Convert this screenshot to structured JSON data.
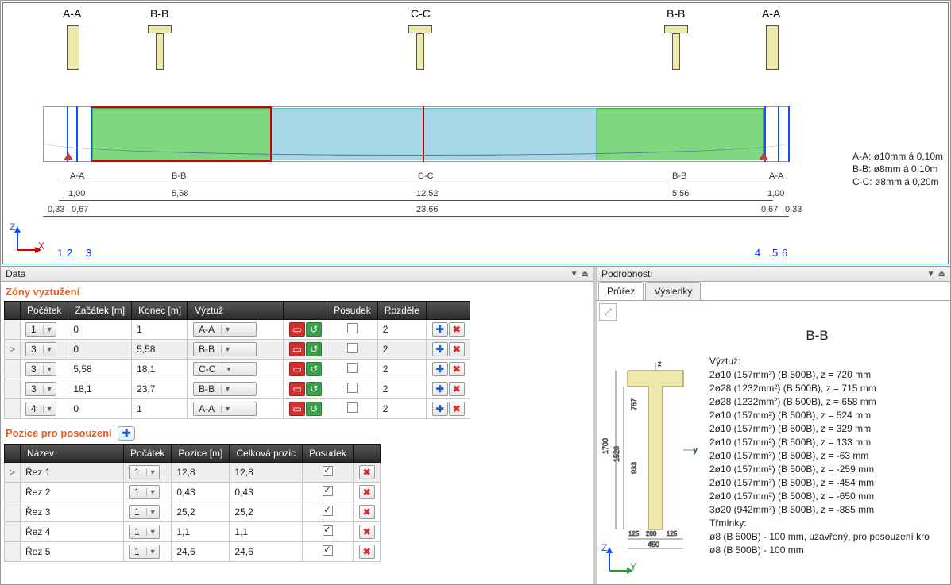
{
  "drawing": {
    "section_labels": [
      "A-A",
      "B-B",
      "C-C",
      "B-B",
      "A-A"
    ],
    "legend": [
      "A-A: ø10mm á 0,10m",
      "B-B: ø8mm á 0,10m",
      "C-C: ø8mm á 0,20m"
    ],
    "dim_row1": {
      "labels": [
        "A-A",
        "B-B",
        "C-C",
        "B-B",
        "A-A"
      ]
    },
    "dim_row2": {
      "labels": [
        "1,00",
        "5,58",
        "12,52",
        "5,56",
        "1,00"
      ]
    },
    "dim_row3": {
      "labels_left": [
        "0,33",
        "0,67"
      ],
      "center": "23,66",
      "labels_right": [
        "0,67",
        "0,33"
      ]
    },
    "nodes_left": [
      "1",
      "2",
      "3"
    ],
    "nodes_right": [
      "4",
      "5",
      "6"
    ],
    "axis_z": "Z",
    "axis_x": "X"
  },
  "panes": {
    "data": "Data",
    "details": "Podrobnosti"
  },
  "zones": {
    "title": "Zóny vyztužení",
    "headers": [
      "Počátek",
      "Začátek [m]",
      "Konec [m]",
      "Výztuž",
      "",
      "Posudek",
      "Rozděle",
      ""
    ],
    "rows": [
      {
        "poc": "1",
        "zac": "0",
        "kon": "1",
        "vyz": "A-A",
        "pos": false,
        "roz": "2",
        "sel": false
      },
      {
        "poc": "3",
        "zac": "0",
        "kon": "5,58",
        "vyz": "B-B",
        "pos": false,
        "roz": "2",
        "sel": true
      },
      {
        "poc": "3",
        "zac": "5,58",
        "kon": "18,1",
        "vyz": "C-C",
        "pos": false,
        "roz": "2",
        "sel": false
      },
      {
        "poc": "3",
        "zac": "18,1",
        "kon": "23,7",
        "vyz": "B-B",
        "pos": false,
        "roz": "2",
        "sel": false
      },
      {
        "poc": "4",
        "zac": "0",
        "kon": "1",
        "vyz": "A-A",
        "pos": false,
        "roz": "2",
        "sel": false
      }
    ]
  },
  "positions": {
    "title": "Pozice pro posouzení",
    "headers": [
      "Název",
      "Počátek",
      "Pozice [m]",
      "Celková pozic",
      "Posudek",
      ""
    ],
    "rows": [
      {
        "name": "Řez 1",
        "poc": "1",
        "poz": "12,8",
        "cel": "12,8",
        "pos": true,
        "sel": true
      },
      {
        "name": "Řez 2",
        "poc": "1",
        "poz": "0,43",
        "cel": "0,43",
        "pos": true,
        "sel": false
      },
      {
        "name": "Řez 3",
        "poc": "1",
        "poz": "25,2",
        "cel": "25,2",
        "pos": true,
        "sel": false
      },
      {
        "name": "Řez 4",
        "poc": "1",
        "poz": "1,1",
        "cel": "1,1",
        "pos": true,
        "sel": false
      },
      {
        "name": "Řez 5",
        "poc": "1",
        "poz": "24,6",
        "cel": "24,6",
        "pos": true,
        "sel": false
      }
    ]
  },
  "details": {
    "tabs": [
      "Průřez",
      "Výsledky"
    ],
    "active_tab": 0,
    "section_name": "B-B",
    "heading": "Výztuž:",
    "lines": [
      "2ø10 (157mm²) (B 500B), z = 720 mm",
      "2ø28 (1232mm²) (B 500B), z = 715 mm",
      "2ø28 (1232mm²) (B 500B), z = 658 mm",
      "2ø10 (157mm²) (B 500B), z = 524 mm",
      "2ø10 (157mm²) (B 500B), z = 329 mm",
      "2ø10 (157mm²) (B 500B), z = 133 mm",
      "2ø10 (157mm²) (B 500B), z = -63 mm",
      "2ø10 (157mm²) (B 500B), z = -259 mm",
      "2ø10 (157mm²) (B 500B), z = -454 mm",
      "2ø10 (157mm²) (B 500B), z = -650 mm",
      "3ø20 (942mm²) (B 500B), z = -885 mm"
    ],
    "stirrups_heading": "Třmínky:",
    "stirrups": [
      "ø8 (B 500B) - 100 mm, uzavřený, pro posouzení kro",
      "ø8 (B 500B) - 100 mm"
    ],
    "dims": {
      "h": "1700",
      "h2": "1520",
      "h3": "933",
      "h4": "767",
      "w1": "125",
      "w2": "200",
      "w3": "125",
      "w": "450"
    },
    "axis_z": "Z",
    "axis_y": "Y"
  }
}
